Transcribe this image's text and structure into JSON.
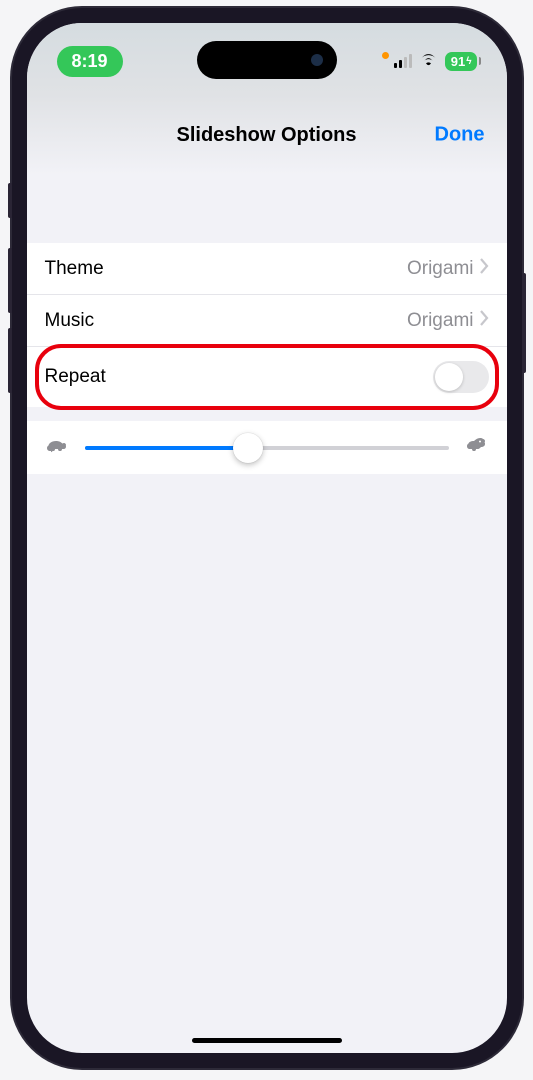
{
  "status": {
    "time": "8:19",
    "battery": "91"
  },
  "header": {
    "title": "Slideshow Options",
    "done": "Done"
  },
  "rows": {
    "theme": {
      "label": "Theme",
      "value": "Origami"
    },
    "music": {
      "label": "Music",
      "value": "Origami"
    },
    "repeat": {
      "label": "Repeat"
    }
  },
  "slider": {
    "position_percent": 45
  }
}
